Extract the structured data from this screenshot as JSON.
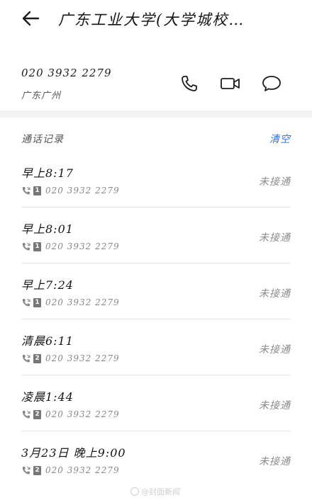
{
  "header": {
    "title": "广东工业大学(大学城校…"
  },
  "contact": {
    "number": "020 3932 2279",
    "location": "广东广州"
  },
  "icons": {
    "back": "back-arrow-icon",
    "call": "phone-icon",
    "video": "video-camera-icon",
    "message": "message-bubble-icon"
  },
  "call_log": {
    "title": "通话记录",
    "clear_label": "清空",
    "items": [
      {
        "time": "早上8:17",
        "sim": "1",
        "number": "020 3932 2279",
        "status": "未接通"
      },
      {
        "time": "早上8:01",
        "sim": "1",
        "number": "020 3932 2279",
        "status": "未接通"
      },
      {
        "time": "早上7:24",
        "sim": "1",
        "number": "020 3932 2279",
        "status": "未接通"
      },
      {
        "time": "清晨6:11",
        "sim": "2",
        "number": "020 3932 2279",
        "status": "未接通"
      },
      {
        "time": "凌晨1:44",
        "sim": "2",
        "number": "020 3932 2279",
        "status": "未接通"
      },
      {
        "time": "3月23日 晚上9:00",
        "sim": "2",
        "number": "020 3932 2279",
        "status": "未接通"
      }
    ]
  },
  "watermark": {
    "text": "@封面新闻"
  },
  "colors": {
    "accent": "#2d6fd6",
    "status": "#8c8c8c",
    "band": "#f3f3f3"
  }
}
